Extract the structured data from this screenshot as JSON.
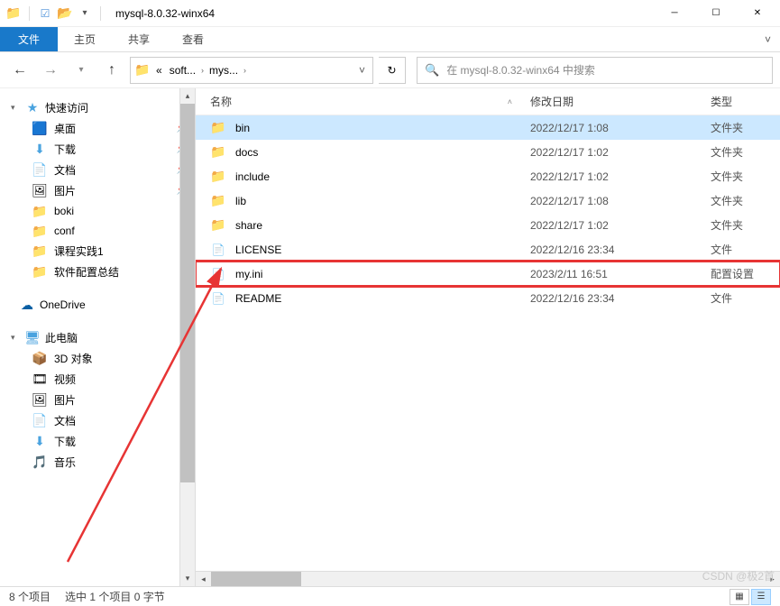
{
  "window": {
    "title": "mysql-8.0.32-winx64",
    "qat_down": "▾"
  },
  "ribbon": {
    "file": "文件",
    "home": "主页",
    "share": "共享",
    "view": "查看"
  },
  "nav": {
    "back": "←",
    "forward": "→",
    "recent": "▾",
    "up": "↑",
    "crumb_prefix": "«",
    "crumb1": "soft...",
    "crumb2": "mys...",
    "refresh": "↻"
  },
  "search": {
    "icon": "🔍",
    "placeholder": "在 mysql-8.0.32-winx64 中搜索"
  },
  "sidebar": {
    "quick_access": "快速访问",
    "items": [
      {
        "label": "桌面",
        "icon": "🟦",
        "pinned": true
      },
      {
        "label": "下载",
        "icon": "⬇",
        "pinned": true
      },
      {
        "label": "文档",
        "icon": "📄",
        "pinned": true
      },
      {
        "label": "图片",
        "icon": "🖼",
        "pinned": true
      },
      {
        "label": "boki",
        "icon": "📁",
        "pinned": false
      },
      {
        "label": "conf",
        "icon": "📁",
        "pinned": false
      },
      {
        "label": "课程实践1",
        "icon": "📁",
        "pinned": false
      },
      {
        "label": "软件配置总结",
        "icon": "📁",
        "pinned": false
      }
    ],
    "onedrive": "OneDrive",
    "this_pc": "此电脑",
    "pc_items": [
      {
        "label": "3D 对象",
        "icon": "📦"
      },
      {
        "label": "视频",
        "icon": "🎞"
      },
      {
        "label": "图片",
        "icon": "🖼"
      },
      {
        "label": "文档",
        "icon": "📄"
      },
      {
        "label": "下载",
        "icon": "⬇"
      },
      {
        "label": "音乐",
        "icon": "🎵"
      }
    ]
  },
  "columns": {
    "name": "名称",
    "modified": "修改日期",
    "type": "类型"
  },
  "files": [
    {
      "name": "bin",
      "date": "2022/12/17 1:08",
      "type": "文件夹",
      "kind": "folder",
      "selected": true
    },
    {
      "name": "docs",
      "date": "2022/12/17 1:02",
      "type": "文件夹",
      "kind": "folder"
    },
    {
      "name": "include",
      "date": "2022/12/17 1:02",
      "type": "文件夹",
      "kind": "folder"
    },
    {
      "name": "lib",
      "date": "2022/12/17 1:08",
      "type": "文件夹",
      "kind": "folder"
    },
    {
      "name": "share",
      "date": "2022/12/17 1:02",
      "type": "文件夹",
      "kind": "folder"
    },
    {
      "name": "LICENSE",
      "date": "2022/12/16 23:34",
      "type": "文件",
      "kind": "file"
    },
    {
      "name": "my.ini",
      "date": "2023/2/11 16:51",
      "type": "配置设置",
      "kind": "ini",
      "highlight": true
    },
    {
      "name": "README",
      "date": "2022/12/16 23:34",
      "type": "文件",
      "kind": "file"
    }
  ],
  "status": {
    "items": "8 个项目",
    "selection": "选中 1 个项目  0 字节"
  },
  "watermark": "CSDN @极2首"
}
